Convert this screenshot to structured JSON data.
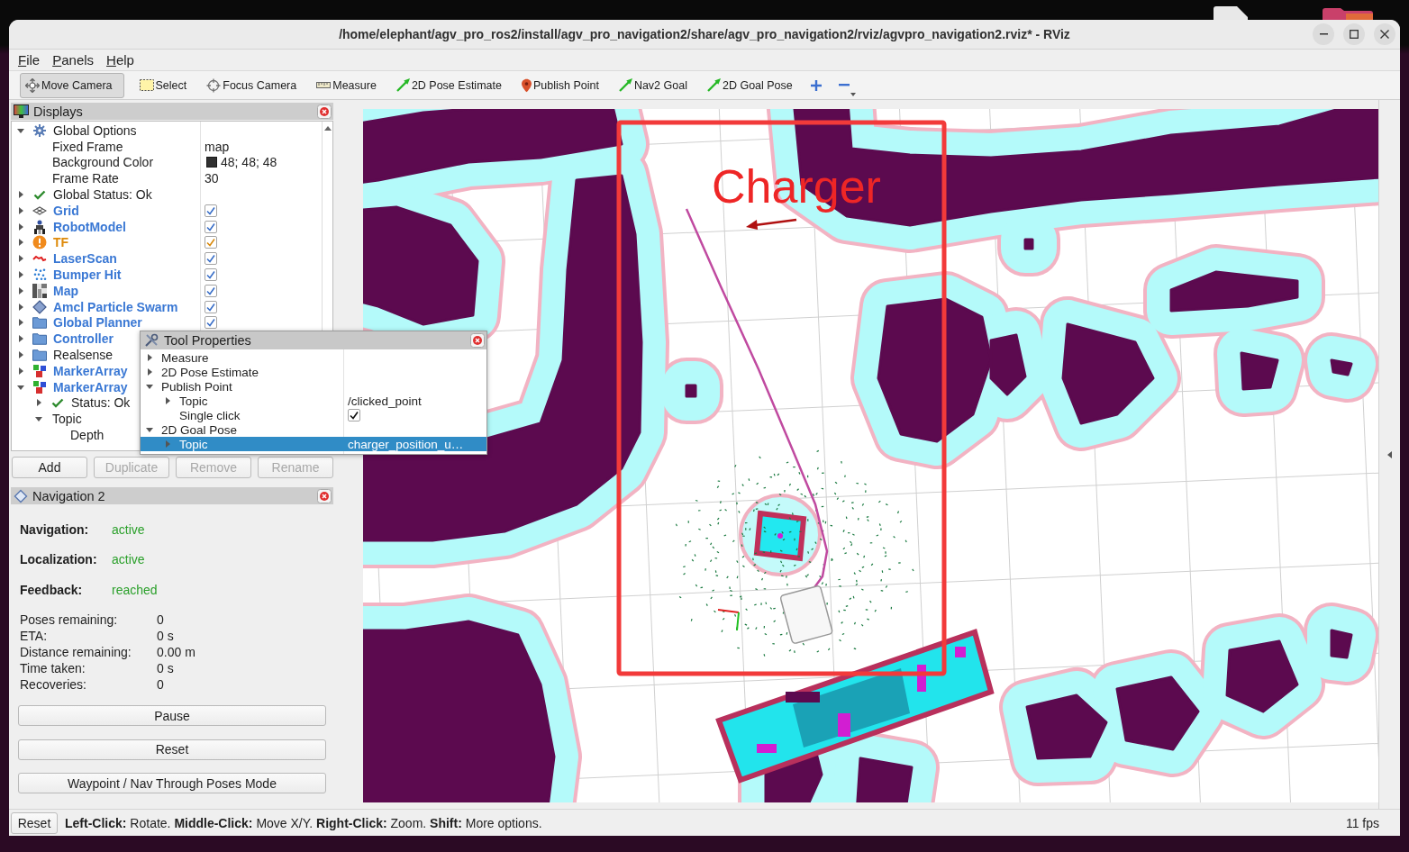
{
  "window": {
    "title": "/home/elephant/agv_pro_ros2/install/agv_pro_navigation2/share/agv_pro_navigation2/rviz/agvpro_navigation2.rviz* - RViz"
  },
  "menu": [
    "File",
    "Panels",
    "Help"
  ],
  "toolbar": [
    {
      "label": "Move Camera",
      "kind": "move_camera",
      "selected": true
    },
    {
      "label": "Select",
      "kind": "select",
      "selected": false
    },
    {
      "label": "Focus Camera",
      "kind": "focus_camera",
      "selected": false
    },
    {
      "label": "Measure",
      "kind": "measure",
      "selected": false
    },
    {
      "label": "2D Pose Estimate",
      "kind": "pose",
      "selected": false
    },
    {
      "label": "Publish Point",
      "kind": "point",
      "selected": false
    },
    {
      "label": "Nav2 Goal",
      "kind": "pose",
      "selected": false
    },
    {
      "label": "2D Goal Pose",
      "kind": "pose",
      "selected": false
    }
  ],
  "displays": {
    "title": "Displays",
    "items": [
      {
        "label": "Global Options",
        "kind": "options",
        "expanded": true,
        "selected": false,
        "children": [
          {
            "label": "Fixed Frame",
            "value": "map",
            "selected": false
          },
          {
            "label": "Background Color",
            "value": "48; 48; 48",
            "color": "#303030",
            "selected": false
          },
          {
            "label": "Frame Rate",
            "value": "30",
            "selected": false
          }
        ]
      },
      {
        "label": "Global Status: Ok",
        "kind": "status_ok",
        "expanded": false,
        "selected": false
      },
      {
        "label": "Grid",
        "kind": "grid",
        "expanded": false,
        "enabled": true,
        "warning": false,
        "checked": true,
        "selected": false
      },
      {
        "label": "RobotModel",
        "kind": "robot_model",
        "expanded": false,
        "enabled": true,
        "warning": false,
        "checked": true,
        "selected": false
      },
      {
        "label": "TF",
        "kind": "tf",
        "expanded": false,
        "enabled": true,
        "warning": true,
        "checked": true,
        "selected": false
      },
      {
        "label": "LaserScan",
        "kind": "laser_scan",
        "expanded": false,
        "enabled": true,
        "warning": false,
        "checked": true,
        "selected": false
      },
      {
        "label": "Bumper Hit",
        "kind": "point_cloud",
        "expanded": false,
        "enabled": true,
        "warning": false,
        "checked": true,
        "selected": false
      },
      {
        "label": "Map",
        "kind": "map",
        "expanded": false,
        "enabled": true,
        "warning": false,
        "checked": true,
        "selected": false
      },
      {
        "label": "Amcl Particle Swarm",
        "kind": "pose_array",
        "expanded": false,
        "enabled": true,
        "warning": false,
        "checked": true,
        "selected": false
      },
      {
        "label": "Global Planner",
        "kind": "group",
        "expanded": false,
        "enabled": true,
        "warning": false,
        "checked": true,
        "selected": false
      },
      {
        "label": "Controller",
        "kind": "group",
        "expanded": false,
        "enabled": true,
        "warning": false,
        "selected": false
      },
      {
        "label": "Realsense",
        "kind": "group",
        "expanded": false,
        "enabled": false,
        "warning": false,
        "selected": false
      },
      {
        "label": "MarkerArray",
        "kind": "marker_array",
        "expanded": false,
        "enabled": true,
        "warning": false,
        "selected": false
      },
      {
        "label": "MarkerArray",
        "kind": "marker_array",
        "expanded": true,
        "enabled": true,
        "warning": false,
        "selected": false,
        "children": [
          {
            "label": "Status: Ok",
            "kind": "status_ok",
            "expanded": false,
            "selected": false
          },
          {
            "label": "Topic",
            "expanded": true,
            "selected": false,
            "children": [
              {
                "label": "Depth",
                "selected": false
              }
            ]
          }
        ]
      }
    ],
    "buttons": [
      {
        "label": "Add",
        "disabled": false
      },
      {
        "label": "Duplicate",
        "disabled": true
      },
      {
        "label": "Remove",
        "disabled": true
      },
      {
        "label": "Rename",
        "disabled": true
      }
    ]
  },
  "tool_properties": {
    "title": "Tool Properties",
    "items": [
      {
        "label": "Measure",
        "expanded": false,
        "selected": false
      },
      {
        "label": "2D Pose Estimate",
        "expanded": false,
        "selected": false
      },
      {
        "label": "Publish Point",
        "expanded": true,
        "selected": false,
        "children": [
          {
            "label": "Topic",
            "expanded": false,
            "value": "/clicked_point",
            "selected": false
          },
          {
            "label": "Single click",
            "checked": true,
            "selected": false
          }
        ]
      },
      {
        "label": "2D Goal Pose",
        "expanded": true,
        "selected": false,
        "children": [
          {
            "label": "Topic",
            "expanded": false,
            "value": "charger_position_u…",
            "selected": true
          }
        ]
      }
    ]
  },
  "navigation": {
    "title": "Navigation 2",
    "status": [
      {
        "label": "Navigation:",
        "value": "active"
      },
      {
        "label": "Localization:",
        "value": "active"
      },
      {
        "label": "Feedback:",
        "value": "reached"
      }
    ],
    "stats": [
      {
        "label": "Poses remaining:",
        "value": "0"
      },
      {
        "label": "ETA:",
        "value": "0 s"
      },
      {
        "label": "Distance remaining:",
        "value": "0.00 m"
      },
      {
        "label": "Time taken:",
        "value": "0 s"
      },
      {
        "label": "Recoveries:",
        "value": "0"
      }
    ],
    "buttons": [
      "Pause",
      "Reset",
      "Waypoint / Nav Through Poses Mode"
    ]
  },
  "viewport": {
    "annotation": "Charger"
  },
  "status_bar": {
    "reset": "Reset",
    "hint": "**Left-Click:** Rotate. **Middle-Click:** Move X/Y. **Right-Click:** Zoom. **Shift:** More options.",
    "fps": "11 fps"
  }
}
